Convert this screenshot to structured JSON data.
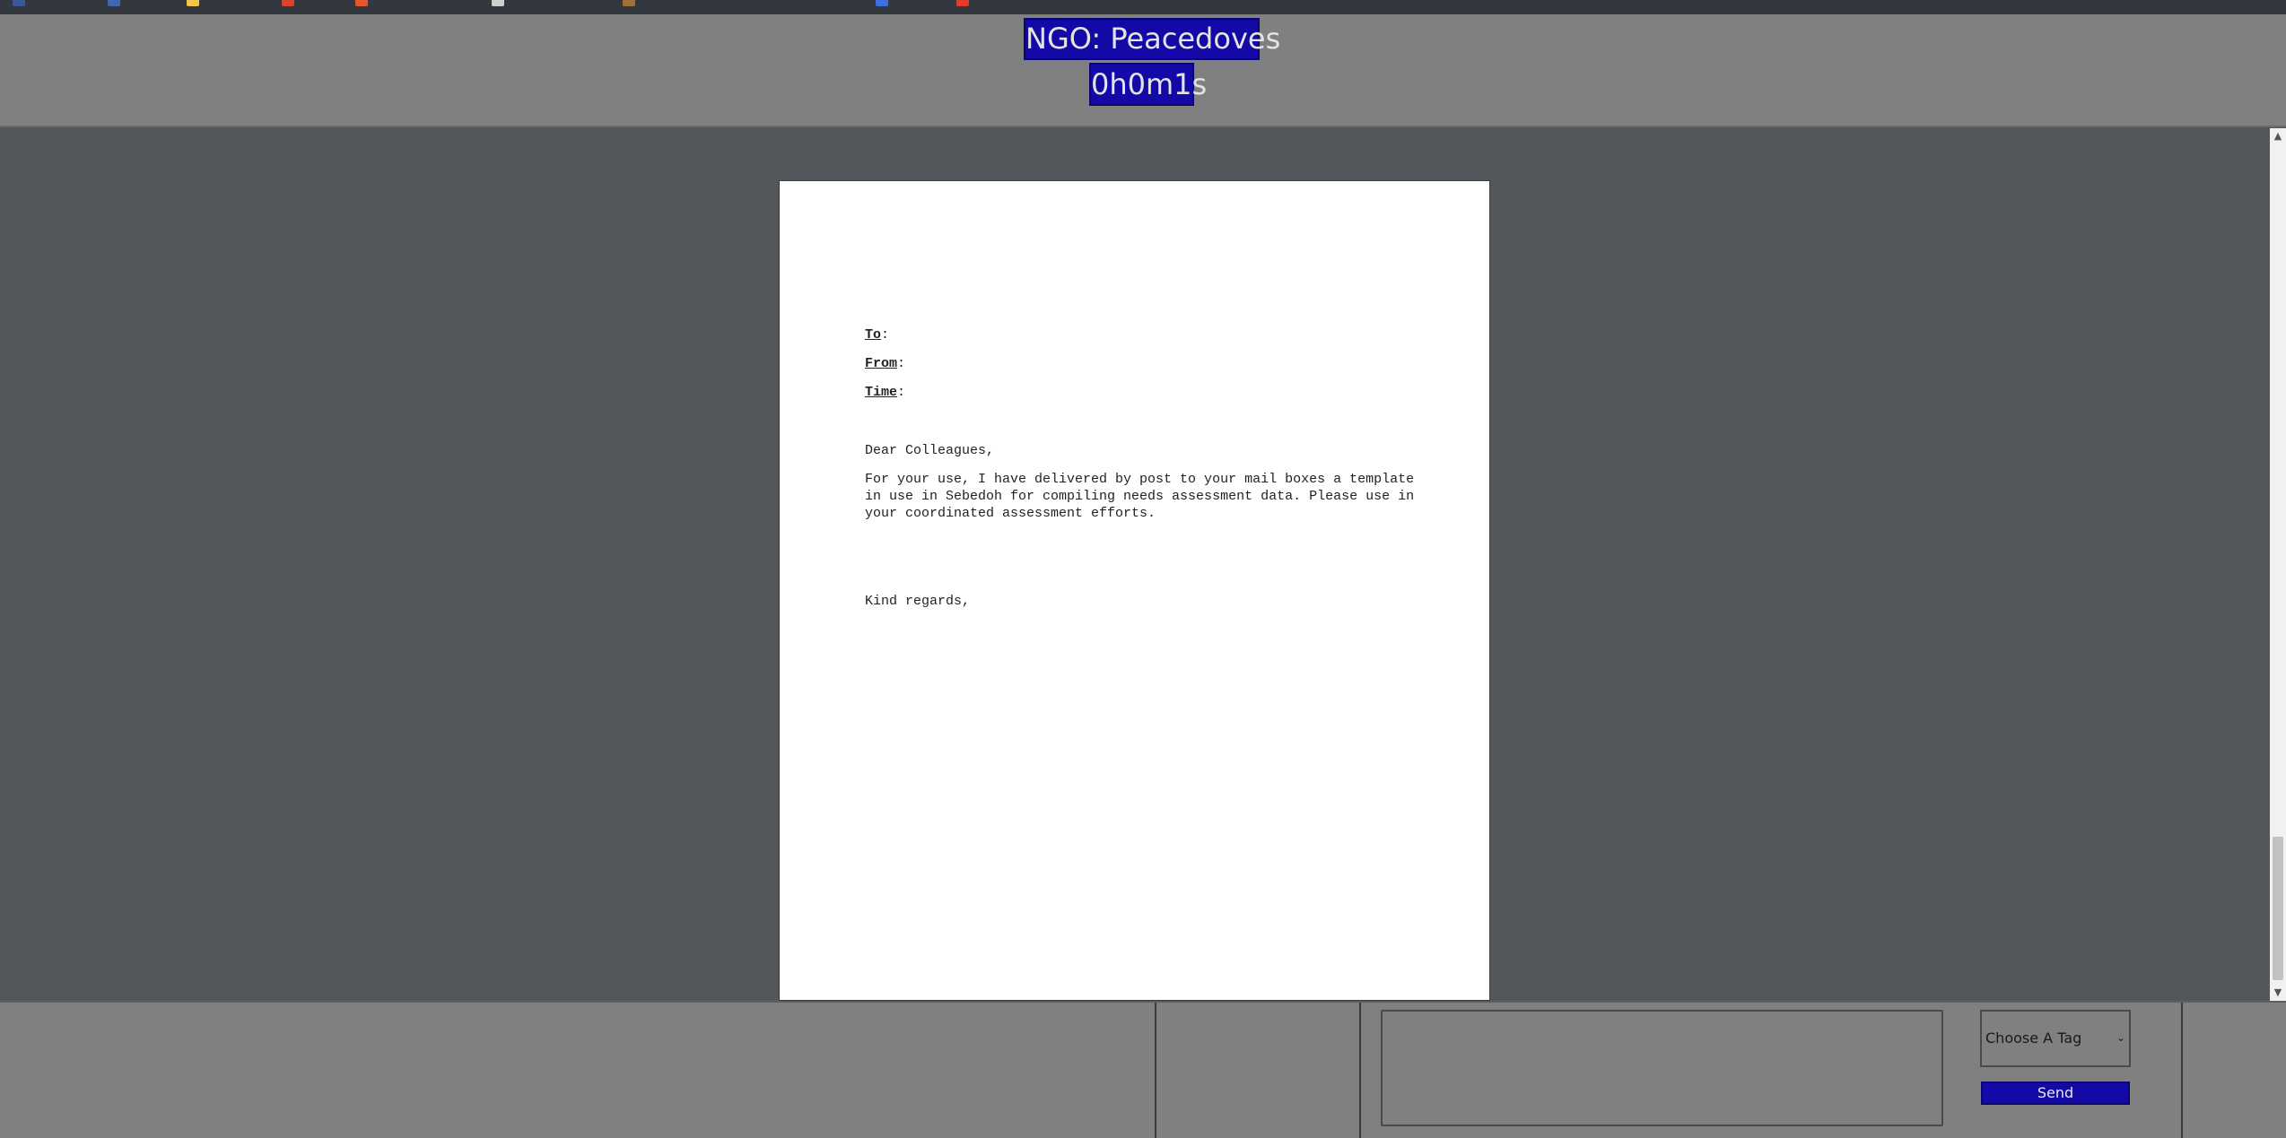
{
  "header": {
    "title": "NGO: Peacedoves",
    "timer": "0h0m1s"
  },
  "letter": {
    "to_label": "To",
    "from_label": "From",
    "time_label": "Time",
    "to_value": "",
    "from_value": "",
    "time_value": "",
    "salutation": "Dear Colleagues,",
    "body": "For your use, I have delivered by post to your mail boxes a template in use in Sebedoh for compiling needs assessment data. Please use in your coordinated assessment efforts.",
    "closing": "Kind regards,"
  },
  "composer": {
    "message_value": "",
    "tag_selected": "Choose A Tag",
    "send_label": "Send"
  },
  "colors": {
    "accent": "#1209a6",
    "header_bg": "#808080",
    "doc_bg": "#53575b"
  },
  "icons": {
    "tag_dropdown": "chevron-down-icon",
    "scroll_up": "arrow-up-icon",
    "scroll_down": "arrow-down-icon"
  }
}
